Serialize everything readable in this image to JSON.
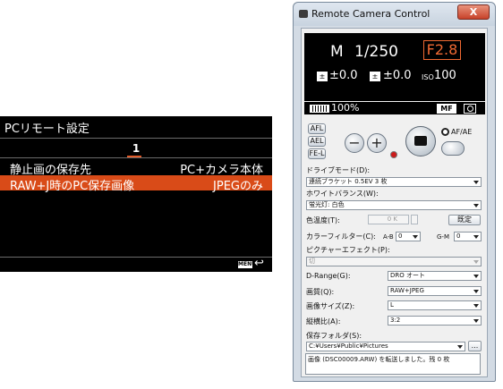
{
  "camera_menu": {
    "title": "PCリモート設定",
    "page": "1",
    "rows": [
      {
        "label": "静止画の保存先",
        "value": "PC+カメラ本体"
      },
      {
        "label": "RAW+J時のPC保存画像",
        "value": "JPEGのみ"
      }
    ],
    "menu_button": "MENU",
    "back_icon": "↩"
  },
  "window": {
    "title": "Remote Camera Control",
    "close": "X",
    "display": {
      "mode": "M",
      "shutter": "1/250",
      "aperture": "F2.8",
      "ev1_icon": "±",
      "ev1": "±0.0",
      "ev2_icon": "±",
      "ev2": "±0.0",
      "iso_label": "ISO",
      "iso": "100",
      "battery": "100%",
      "focus_mode": "MF"
    },
    "controls": {
      "afl": "AFL",
      "ael": "AEL",
      "fel": "FE-L",
      "minus": "−",
      "plus": "+",
      "af_ae": "AF/AE"
    },
    "settings": {
      "drive_label": "ドライブモード(D):",
      "drive_value": "連続ブラケット 0.5EV 3 枚",
      "wb_label": "ホワイトバランス(W):",
      "wb_value": "蛍光灯: 白色",
      "color_temp_label": "色温度(T):",
      "color_temp_value": "0 K",
      "preset_button": "既定",
      "color_filter_label": "カラーフィルター(C):",
      "ab_label": "A-B",
      "ab_value": "0",
      "gm_label": "G-M",
      "gm_value": "0",
      "picture_effect_label": "ピクチャーエフェクト(P):",
      "picture_effect_value": "切",
      "drange_label": "D-Range(G):",
      "drange_value": "DRO オート",
      "quality_label": "画質(Q):",
      "quality_value": "RAW+JPEG",
      "size_label": "画像サイズ(Z):",
      "size_value": "L",
      "aspect_label": "縦横比(A):",
      "aspect_value": "3:2",
      "folder_label": "保存フォルダ(S):",
      "folder_value": "C:¥Users¥Public¥Pictures",
      "browse_button": "...",
      "log_text": "画像 (DSC00009.ARW) を転送しました。残 0 枚"
    }
  }
}
